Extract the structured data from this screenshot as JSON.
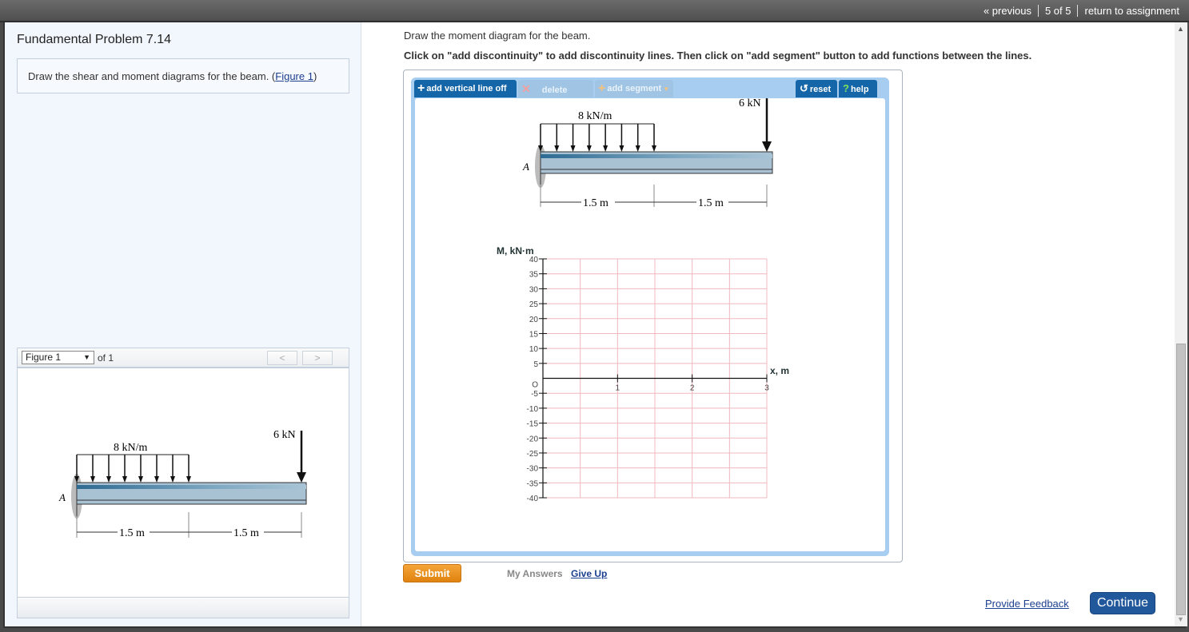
{
  "topnav": {
    "previous": "« previous",
    "position": "5 of 5",
    "return": "return to assignment"
  },
  "left": {
    "title": "Fundamental Problem 7.14",
    "prompt_text": "Draw the shear and moment diagrams for the beam. (",
    "prompt_link": "Figure 1",
    "prompt_close": ")",
    "figure_select": "Figure 1",
    "figure_of": "of 1",
    "prev_icon": "<",
    "next_icon": ">"
  },
  "figure": {
    "distributed_load": "8 kN/m",
    "point_load": "6 kN",
    "support_label": "A",
    "dim1": "1.5 m",
    "dim2": "1.5 m"
  },
  "question": {
    "line1": "Draw the moment diagram for the beam.",
    "line2": "Click on \"add discontinuity\" to add discontinuity lines. Then click on \"add segment\" button to add functions between the lines."
  },
  "toolbar": {
    "add_vertical": "add vertical line off",
    "delete": "delete",
    "add_segment": "add segment",
    "reset": "reset",
    "help": "help"
  },
  "chart_data": {
    "type": "line",
    "title": "",
    "ylabel": "M, kN·m",
    "xlabel": "x, m",
    "xlim": [
      0,
      3
    ],
    "ylim": [
      -40,
      40
    ],
    "x_ticks": [
      "1",
      "2",
      "3"
    ],
    "y_ticks": [
      "40",
      "35",
      "30",
      "25",
      "20",
      "15",
      "10",
      "5",
      "O",
      "-5",
      "-10",
      "-15",
      "-20",
      "-25",
      "-30",
      "-35",
      "-40"
    ],
    "series": [],
    "grid": true
  },
  "actions": {
    "submit": "Submit",
    "my_answers": "My Answers",
    "give_up": "Give Up",
    "feedback": "Provide Feedback",
    "continue": "Continue"
  },
  "colors": {
    "accent": "#1566a8",
    "submit": "#e98b1c",
    "continue": "#21579b",
    "grid": "#f0b8c0"
  }
}
